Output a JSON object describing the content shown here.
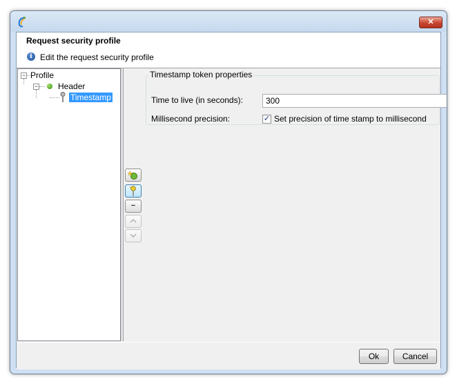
{
  "window": {
    "close_label": "✕"
  },
  "header": {
    "title": "Request security profile",
    "subtitle": "Edit the request security profile"
  },
  "tree": {
    "root": "Profile",
    "child": "Header",
    "leaf": "Timestamp"
  },
  "toolbar": {
    "add_icon": "add-element-icon",
    "key_icon": "key-icon",
    "remove_label": "−",
    "up_label": "^",
    "down_label": "v"
  },
  "properties": {
    "group_title": "Timestamp token properties",
    "ttl_label": "Time to live (in seconds):",
    "ttl_value": "300",
    "precision_label": "Millisecond precision:",
    "precision_checked": true,
    "precision_checkbox_label": "Set precision of time stamp to millisecond"
  },
  "footer": {
    "ok_label": "Ok",
    "cancel_label": "Cancel"
  },
  "colors": {
    "selection": "#3399ff",
    "titlebar": "#cfe0f3",
    "close": "#c8452e"
  }
}
